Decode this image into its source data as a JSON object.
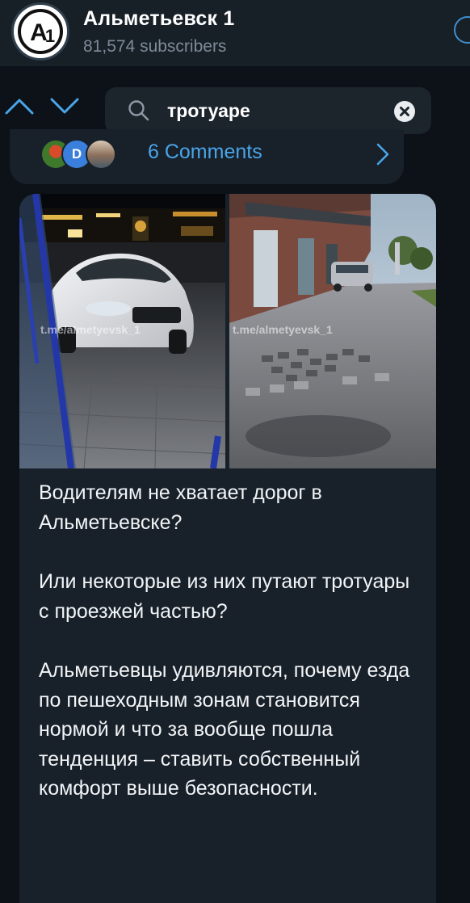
{
  "channel": {
    "title": "Альметьевск 1",
    "subscribers": "81,574 subscribers",
    "logo_text": "A1"
  },
  "search": {
    "query": "тротуаре"
  },
  "previous_message": {
    "comments_label": "6 Comments",
    "commenter_initial": "D"
  },
  "message": {
    "watermark": "t.me/almetyevsk_1",
    "paragraphs": [
      "Водителям не хватает дорог в Альметьевске?",
      "Или некоторые из них путают тротуары с проезжей частью?",
      "Альметьевцы удивляются, почему езда по пешеходным зонам становится нормой и что за вообще пошла тенденция – ставить собственный комфорт выше безопасности."
    ]
  },
  "colors": {
    "header_bg": "#171f27",
    "bubble_bg": "#18212a",
    "accent": "#4aa4e8",
    "page_bg": "#0c1217"
  },
  "icons": [
    "arrow-up-icon",
    "arrow-down-icon",
    "search-icon",
    "clear-icon",
    "chevron-right-icon"
  ]
}
